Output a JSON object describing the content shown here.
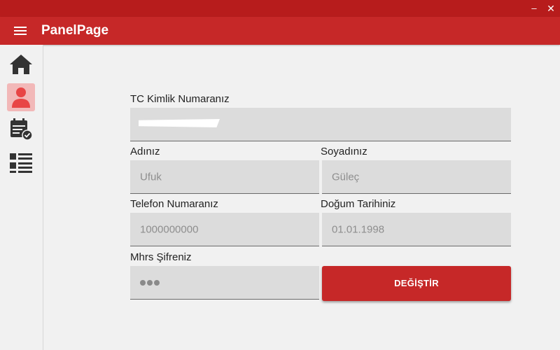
{
  "app": {
    "title": "PanelPage",
    "window_controls": {
      "minimize": "–",
      "close": "✕"
    },
    "colors": {
      "title_strip": "#b71c1c",
      "app_bar": "#c62828",
      "accent": "#c62828",
      "active_nav": "#f2b8b8",
      "icon": "#333333",
      "active_icon": "#e84545"
    }
  },
  "sidebar": {
    "items": [
      {
        "icon": "home-icon",
        "active": false
      },
      {
        "icon": "user-icon",
        "active": true
      },
      {
        "icon": "calendar-check-icon",
        "active": false
      },
      {
        "icon": "list-icon",
        "active": false
      }
    ]
  },
  "form": {
    "tc": {
      "label": "TC Kimlik Numaranız",
      "value": ""
    },
    "first_name": {
      "label": "Adınız",
      "value": "Ufuk"
    },
    "last_name": {
      "label": "Soyadınız",
      "value": "Güleç"
    },
    "phone": {
      "label": "Telefon Numaranız",
      "value": "1000000000"
    },
    "birth_date": {
      "label": "Doğum Tarihiniz",
      "value": "01.01.1998"
    },
    "password": {
      "label": "Mhrs Şifreniz",
      "masked_length": 3
    },
    "change_button": "DEĞİŞTİR"
  }
}
